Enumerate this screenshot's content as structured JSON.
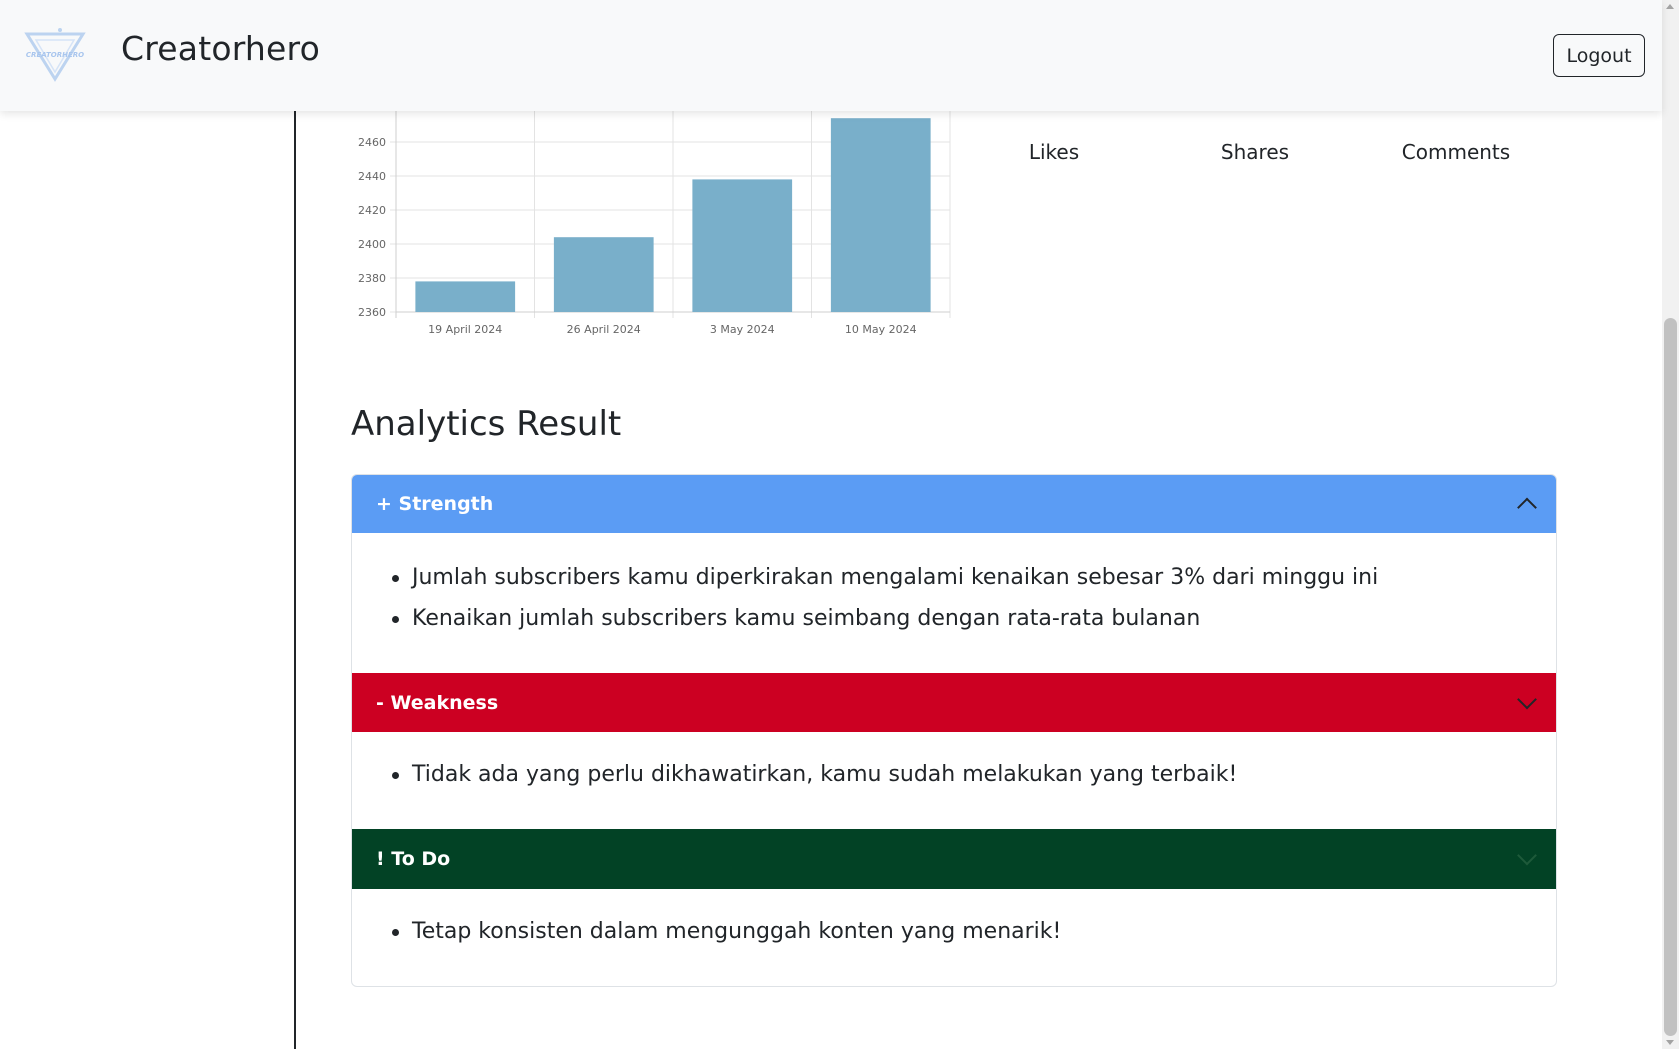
{
  "navbar": {
    "brand": "Creatorhero",
    "logo_text": "CREATORHERO",
    "logout_label": "Logout"
  },
  "stats": {
    "likes_label": "Likes",
    "shares_label": "Shares",
    "comments_label": "Comments"
  },
  "chart_data": {
    "type": "bar",
    "categories": [
      "19 April 2024",
      "26 April 2024",
      "3 May 2024",
      "10 May 2024"
    ],
    "values": [
      2378,
      2404,
      2438,
      2474
    ],
    "ylim": [
      2360,
      2480
    ],
    "yticks": [
      2360,
      2380,
      2400,
      2420,
      2440,
      2460
    ],
    "grid": true,
    "bar_color": "#79afca"
  },
  "analytics": {
    "title": "Analytics Result",
    "sections": [
      {
        "header": "+ Strength",
        "color": "#5b9cf4",
        "expanded": true,
        "items": [
          "Jumlah subscribers kamu diperkirakan mengalami kenaikan sebesar 3% dari minggu ini",
          "Kenaikan jumlah subscribers kamu seimbang dengan rata-rata bulanan"
        ]
      },
      {
        "header": "- Weakness",
        "color": "#cc0022",
        "expanded": false,
        "items": [
          "Tidak ada yang perlu dikhawatirkan, kamu sudah melakukan yang terbaik!"
        ]
      },
      {
        "header": "! To Do",
        "color": "#024225",
        "expanded": false,
        "items": [
          "Tetap konsisten dalam mengunggah konten yang menarik!"
        ]
      }
    ]
  },
  "icons": [
    "logo-icon",
    "chevron-up-icon",
    "chevron-down-icon"
  ]
}
